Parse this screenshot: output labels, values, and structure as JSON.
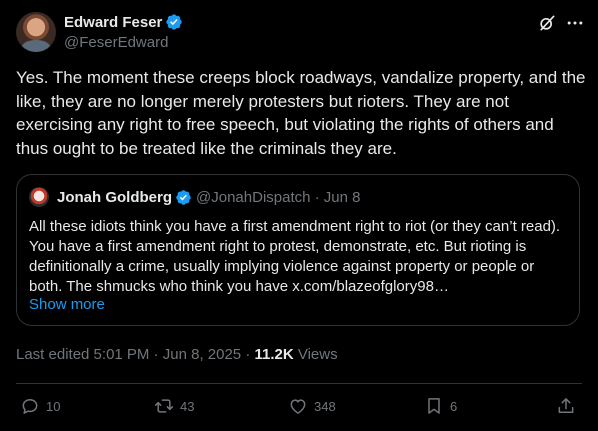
{
  "author": {
    "name": "Edward Feser",
    "handle": "@FeserEdward"
  },
  "tweet": {
    "text": "Yes. The moment these creeps block roadways, vandalize property, and the like, they are no longer merely protesters but rioters. They are not exercising any right to free speech, but violating the rights of others and thus ought to be treated like the criminals they are."
  },
  "quote": {
    "name": "Jonah Goldberg",
    "handle_date": "@JonahDispatch · Jun 8",
    "text": "All these idiots think you have a first amendment right to riot (or they can’t read). You have a first amendment right to protest, demonstrate, etc. But rioting is definitionally a crime, usually implying violence against property or people or both. The shmucks who think you have x.com/blazeofglory98…",
    "show_more": "Show more"
  },
  "meta": {
    "edited": "Last edited 5:01 PM · Jun 8, 2025 · ",
    "views_count": "11.2K",
    "views_label": " Views"
  },
  "actions": {
    "replies": "10",
    "reposts": "43",
    "likes": "348",
    "bookmarks": "6"
  },
  "colors": {
    "background": "#000000",
    "text": "#e7e9ea",
    "muted": "#71767b",
    "accent": "#1d9bf0",
    "border": "#2f3336"
  },
  "icons": [
    "verified-badge-icon",
    "grok-icon",
    "more-icon",
    "reply-icon",
    "repost-icon",
    "like-icon",
    "bookmark-icon",
    "share-icon"
  ]
}
